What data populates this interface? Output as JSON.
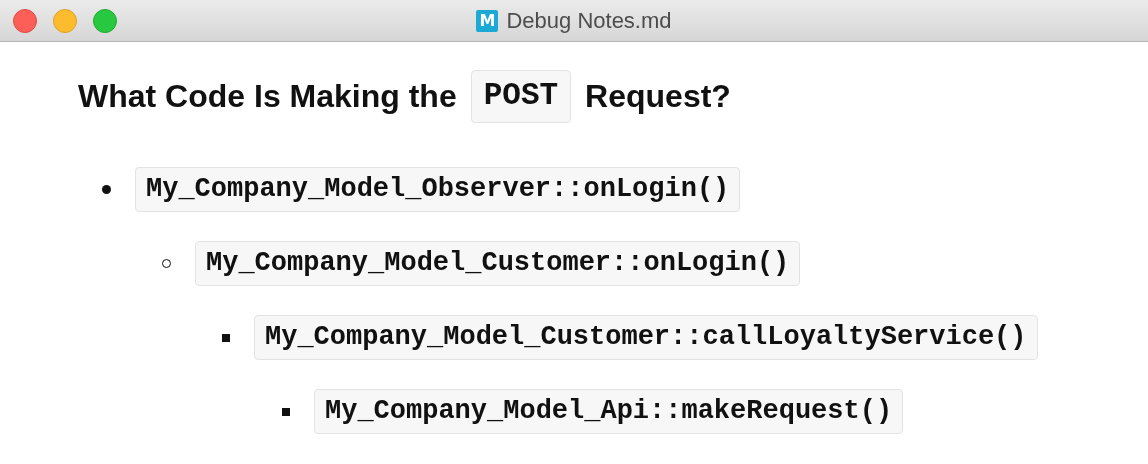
{
  "window": {
    "title": "Debug Notes.md",
    "icon_letter": "M"
  },
  "heading": [
    {
      "kind": "text",
      "text": "What Code Is Making the"
    },
    {
      "kind": "code",
      "text": "POST"
    },
    {
      "kind": "text",
      "text": "Request?"
    }
  ],
  "list": [
    {
      "code": "My_Company_Model_Observer::onLogin()",
      "children": [
        {
          "code": "My_Company_Model_Customer::onLogin()",
          "children": [
            {
              "code": "My_Company_Model_Customer::callLoyaltyService()",
              "children": [
                {
                  "code": "My_Company_Model_Api::makeRequest()"
                }
              ]
            }
          ]
        }
      ]
    }
  ]
}
